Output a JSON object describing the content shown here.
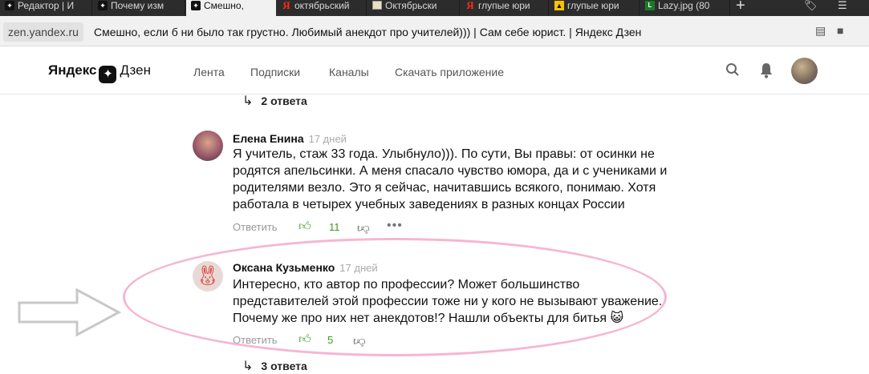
{
  "browser": {
    "tabs": [
      {
        "label": "Редактор | И",
        "icon": "zen-icon",
        "active": false
      },
      {
        "label": "Почему изм",
        "icon": "zen-icon",
        "active": false
      },
      {
        "label": "Смешно,",
        "icon": "zen-icon",
        "active": true
      },
      {
        "label": "октябрьский",
        "icon": "yandex-icon",
        "active": false
      },
      {
        "label": "Октябрьски",
        "icon": "image-icon",
        "active": false
      },
      {
        "label": "глупые юри",
        "icon": "yandex-icon",
        "active": false
      },
      {
        "label": "глупые юри",
        "icon": "yellow-icon",
        "active": false
      },
      {
        "label": "Lazy.jpg (80",
        "icon": "image-file-icon",
        "active": false
      }
    ],
    "new_tab": "+",
    "address": {
      "host": "zen.yandex.ru",
      "title": "Смешно, если б ни было так грустно. Любимый анекдот про учителей))) | Сам себе юрист. | Яндекс Дзен"
    }
  },
  "header": {
    "logo_text": "Яндекс",
    "logo_brand": "Дзен",
    "nav": [
      "Лента",
      "Подписки",
      "Каналы",
      "Скачать приложение"
    ]
  },
  "comments": {
    "replies_above": "2 ответа",
    "items": [
      {
        "author": "Елена Енина",
        "time": "17 дней",
        "lines": [
          "Я учитель, стаж 33 года. Улыбнуло))). По сути, Вы правы: от осинки не",
          "родятся апельсинки. А меня спасало чувство юмора, да и с учениками и",
          "родителями везло. Это я сейчас, начитавшись всякого, понимаю. Хотя",
          "работала в четырех учебных заведениях в разных концах России"
        ],
        "reply_label": "Ответить",
        "likes": "11"
      },
      {
        "author": "Оксана Кузьменко",
        "time": "17 дней",
        "lines": [
          "Интересно, кто автор по профессии? Может большинство",
          "представителей этой профессии тоже ни у кого не вызывают уважение.",
          "Почему же про них нет анекдотов!? Нашли объекты для битья 😺"
        ],
        "reply_label": "Ответить",
        "likes": "5"
      }
    ],
    "replies_below": "3 ответа"
  },
  "colors": {
    "like_green": "#3c9a1a",
    "highlight_ellipse": "#f6b6d2",
    "annotation_arrow": "#c8c8c8"
  }
}
